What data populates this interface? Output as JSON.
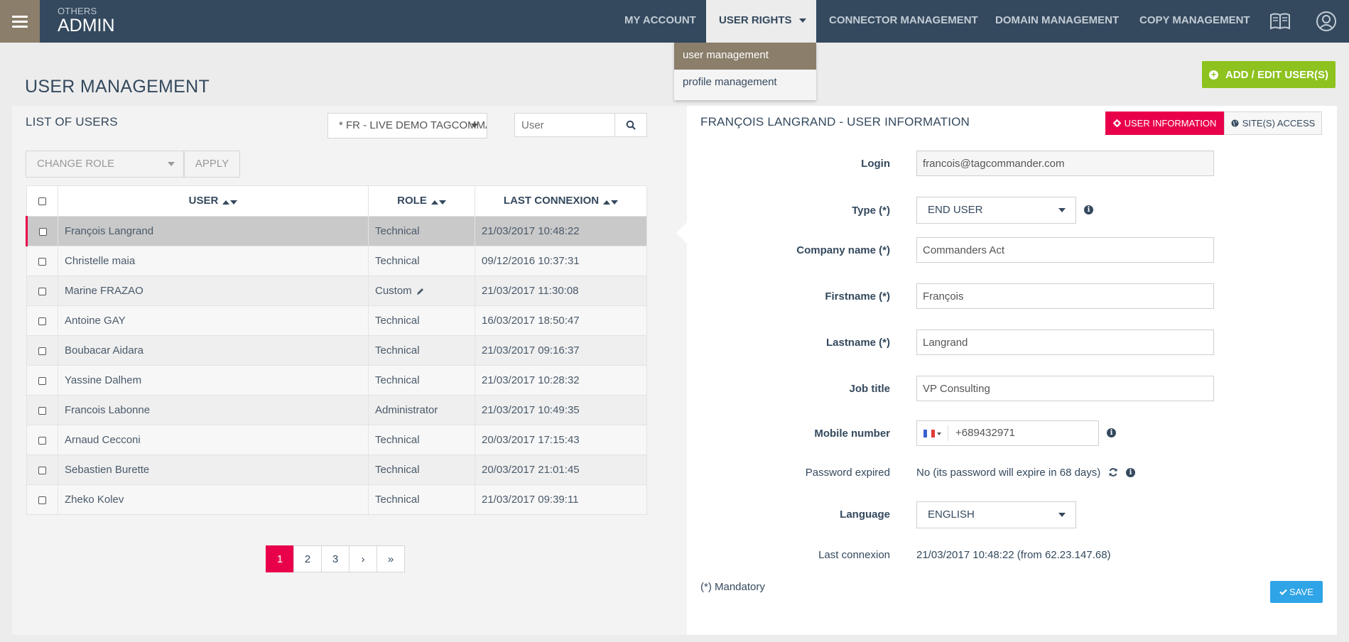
{
  "header": {
    "section": "OTHERS",
    "title": "ADMIN",
    "nav": {
      "my_account": "MY ACCOUNT",
      "user_rights": "USER RIGHTS",
      "connector_management": "CONNECTOR MANAGEMENT",
      "domain_management": "DOMAIN MANAGEMENT",
      "copy_management": "COPY MANAGEMENT"
    },
    "icons": [
      "menu-icon",
      "book-icon",
      "user-circle-icon"
    ]
  },
  "dropdown": {
    "items": [
      "user management",
      "profile management"
    ],
    "selected": "user management"
  },
  "page": {
    "title": "USER MANAGEMENT",
    "add_button": "ADD / EDIT USER(S)"
  },
  "list": {
    "title": "LIST OF USERS",
    "site_select": "* FR - LIVE DEMO TAGCOMMANDER",
    "search_placeholder": "User",
    "change_role_placeholder": "CHANGE ROLE",
    "apply_label": "APPLY",
    "columns": {
      "user": "USER",
      "role": "ROLE",
      "last": "LAST CONNEXION"
    },
    "rows": [
      {
        "user": "François Langrand",
        "role": "Technical",
        "last": "21/03/2017 10:48:22"
      },
      {
        "user": "Christelle maia",
        "role": "Technical",
        "last": "09/12/2016 10:37:31"
      },
      {
        "user": "Marine FRAZAO",
        "role": "Custom",
        "last": "21/03/2017 11:30:08"
      },
      {
        "user": "Antoine GAY",
        "role": "Technical",
        "last": "16/03/2017 18:50:47"
      },
      {
        "user": "Boubacar Aidara",
        "role": "Technical",
        "last": "21/03/2017 09:16:37"
      },
      {
        "user": "Yassine Dalhem",
        "role": "Technical",
        "last": "21/03/2017 10:28:32"
      },
      {
        "user": "Francois Labonne",
        "role": "Administrator",
        "last": "21/03/2017 10:49:35"
      },
      {
        "user": "Arnaud Cecconi",
        "role": "Technical",
        "last": "20/03/2017 17:15:43"
      },
      {
        "user": "Sebastien Burette",
        "role": "Technical",
        "last": "20/03/2017 21:01:45"
      },
      {
        "user": "Zheko Kolev",
        "role": "Technical",
        "last": "21/03/2017 09:39:11"
      }
    ],
    "pagination": {
      "pages": [
        "1",
        "2",
        "3"
      ],
      "current": "1",
      "next": "›",
      "last": "»"
    }
  },
  "detail": {
    "title": "FRANÇOIS LANGRAND - USER INFORMATION",
    "tab_info": "USER INFORMATION",
    "tab_access": "SITE(S) ACCESS",
    "labels": {
      "login": "Login",
      "type": "Type (*)",
      "company": "Company name (*)",
      "firstname": "Firstname (*)",
      "lastname": "Lastname (*)",
      "job": "Job title",
      "mobile": "Mobile number",
      "password": "Password expired",
      "language": "Language",
      "last": "Last connexion"
    },
    "values": {
      "login": "francois@tagcommander.com",
      "type": "END USER",
      "company": "Commanders Act",
      "firstname": "François",
      "lastname": "Langrand",
      "job": "VP Consulting",
      "mobile": "+689432971",
      "password": "No (its password will expire in 68 days)",
      "language": "ENGLISH",
      "last": "21/03/2017 10:48:22 (from 62.23.147.68)"
    },
    "mandatory_note": "(*) Mandatory",
    "save_label": "SAVE"
  },
  "colors": {
    "topbar": "#34495e",
    "menu_bg": "#8b7e6a",
    "accent_pink": "#e9004b",
    "add_green": "#8dc21f",
    "save_blue": "#2fa4e7"
  }
}
